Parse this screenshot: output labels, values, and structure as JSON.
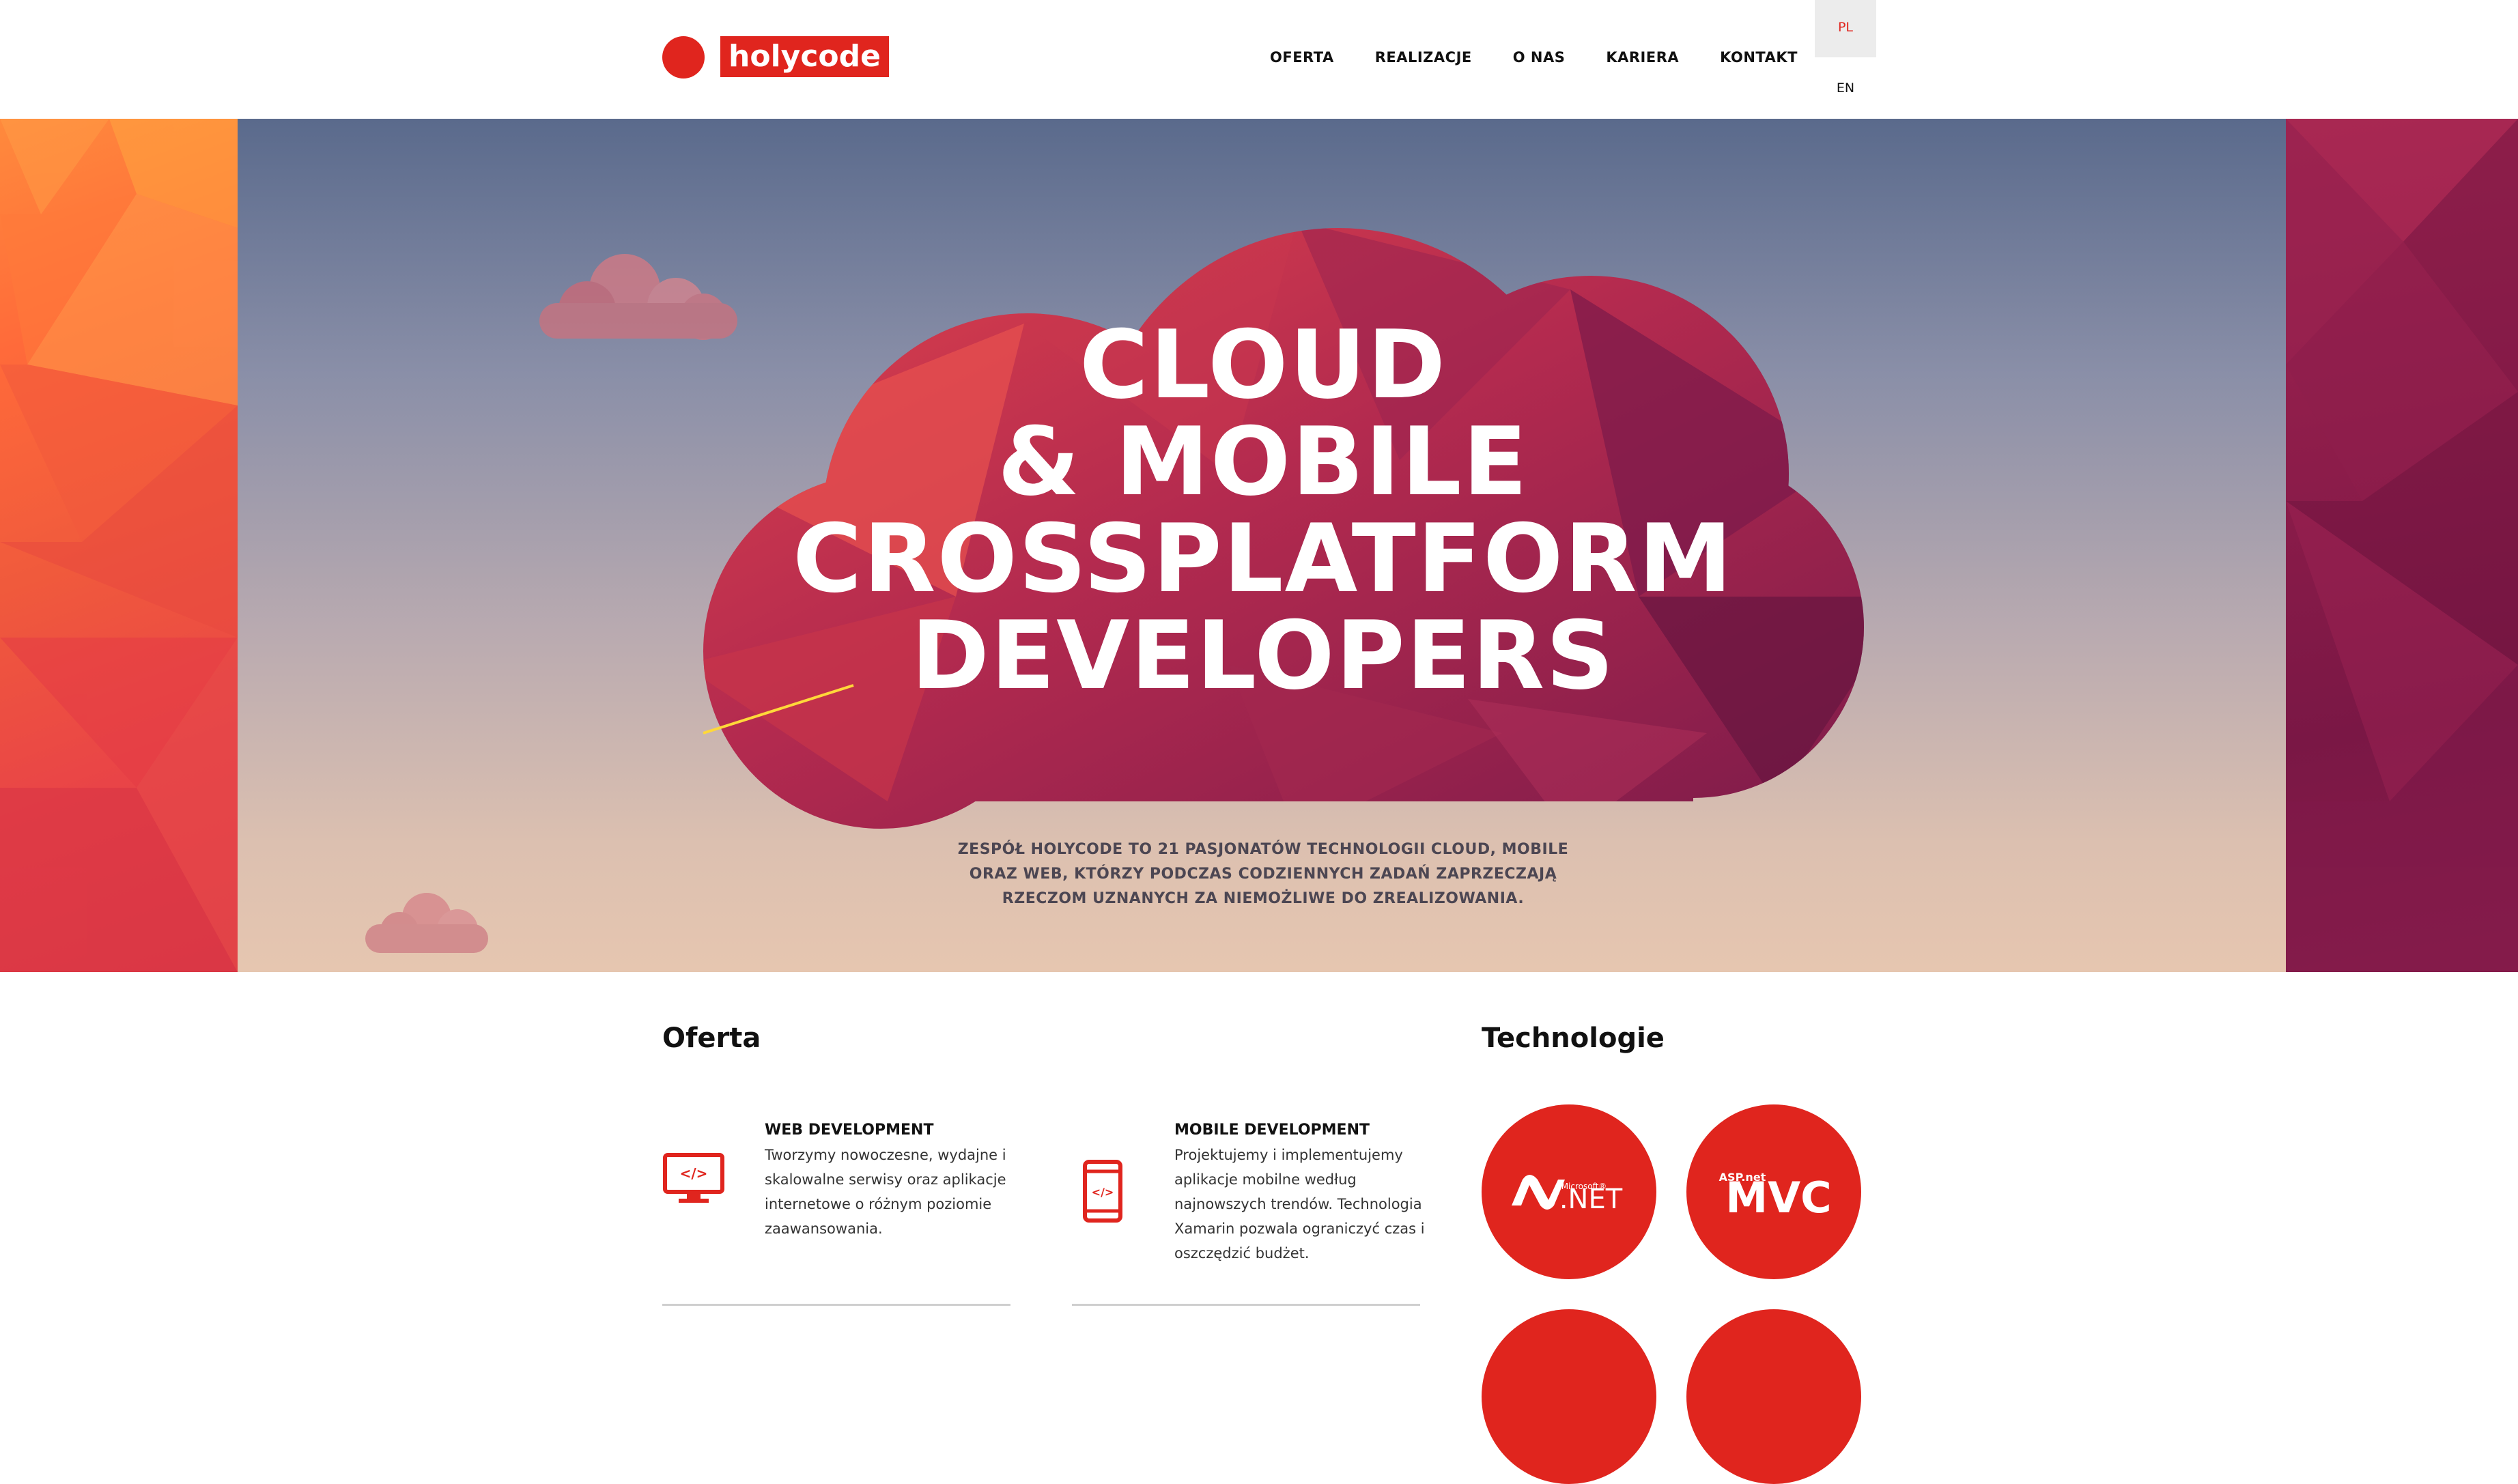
{
  "brand": {
    "logo_text": "holycode"
  },
  "nav": {
    "items": [
      "OFERTA",
      "REALIZACJE",
      "O NAS",
      "KARIERA",
      "KONTAKT"
    ]
  },
  "lang": {
    "pl": "PL",
    "en": "EN"
  },
  "hero": {
    "title_lines": [
      "CLOUD",
      "& MOBILE",
      "CROSSPLATFORM",
      "DEVELOPERS"
    ],
    "desc_lines": [
      "ZESPÓŁ HOLYCODE TO 21 PASJONATÓW TECHNOLOGII CLOUD, MOBILE",
      "ORAZ WEB, KTÓRZY PODCZAS CODZIENNYCH ZADAŃ ZAPRZECZAJĄ",
      "RZECZOM UZNANYCH ZA NIEMOŻLIWE DO ZREALIZOWANIA."
    ]
  },
  "offer": {
    "title": "Oferta",
    "items": [
      {
        "icon": "monitor-code-icon",
        "title": "WEB DEVELOPMENT",
        "lines": [
          "Tworzymy nowoczesne, wydajne i",
          "skalowalne serwisy oraz aplikacje",
          "internetowe o różnym poziomie",
          "zaawansowania."
        ]
      },
      {
        "icon": "mobile-code-icon",
        "title": "MOBILE DEVELOPMENT",
        "lines": [
          "Projektujemy i implementujemy",
          "aplikacje mobilne według",
          "najnowszych trendów. Technologia",
          "Xamarin pozwala ograniczyć czas i",
          "oszczędzić budżet."
        ]
      }
    ]
  },
  "technologies": {
    "title": "Technologie",
    "items": [
      {
        "name": ".NET",
        "badge": "Microsoft®",
        "icon": "dotnet-logo-icon"
      },
      {
        "name": "MVC",
        "badge": "ASP.net",
        "icon": "aspnet-mvc-logo-icon"
      }
    ]
  },
  "colors": {
    "accent": "#e0251e",
    "hero_cloud": "#b32a4f",
    "text_dark": "#111111"
  }
}
